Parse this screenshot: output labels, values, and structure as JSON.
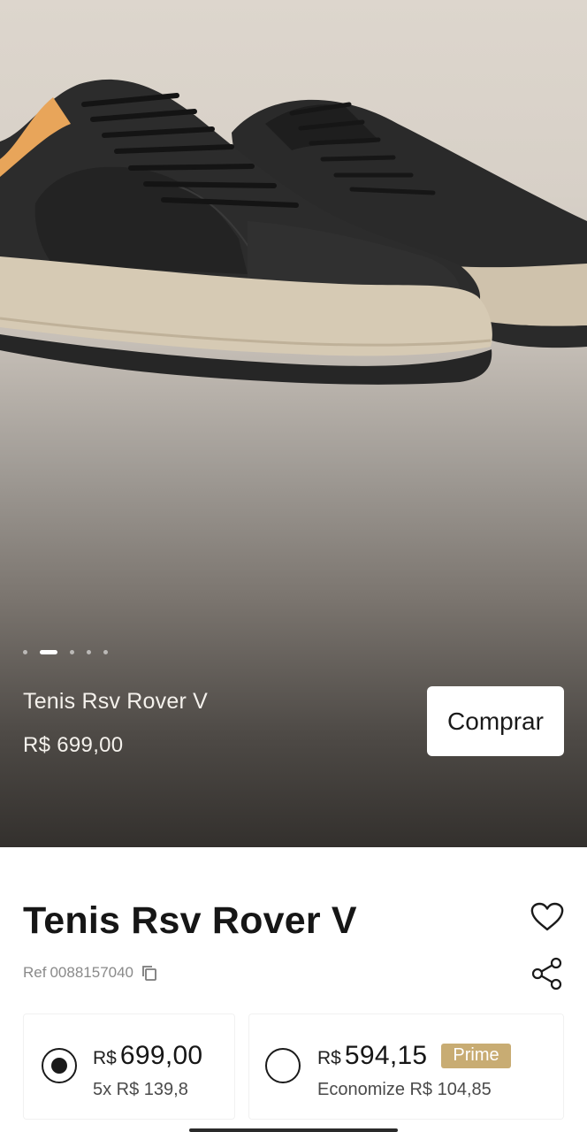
{
  "hero": {
    "title": "Tenis Rsv Rover V",
    "price": "R$ 699,00",
    "buy_label": "Comprar",
    "carousel_count": 5,
    "carousel_active_index": 1
  },
  "product": {
    "title": "Tenis Rsv Rover V",
    "ref_label": "Ref",
    "ref_code": "0088157040"
  },
  "options": [
    {
      "currency": "R$",
      "amount": "699,00",
      "sub": "5x R$ 139,8",
      "selected": true
    },
    {
      "currency": "R$",
      "amount": "594,15",
      "badge": "Prime",
      "sub": "Economize R$ 104,85",
      "selected": false
    }
  ],
  "icons": {
    "favorite": "heart-icon",
    "share": "share-icon",
    "copy": "copy-icon"
  },
  "colors": {
    "prime_badge": "#c8ac73",
    "hero_top": "#ddd6cd",
    "hero_bottom": "#33302d"
  }
}
